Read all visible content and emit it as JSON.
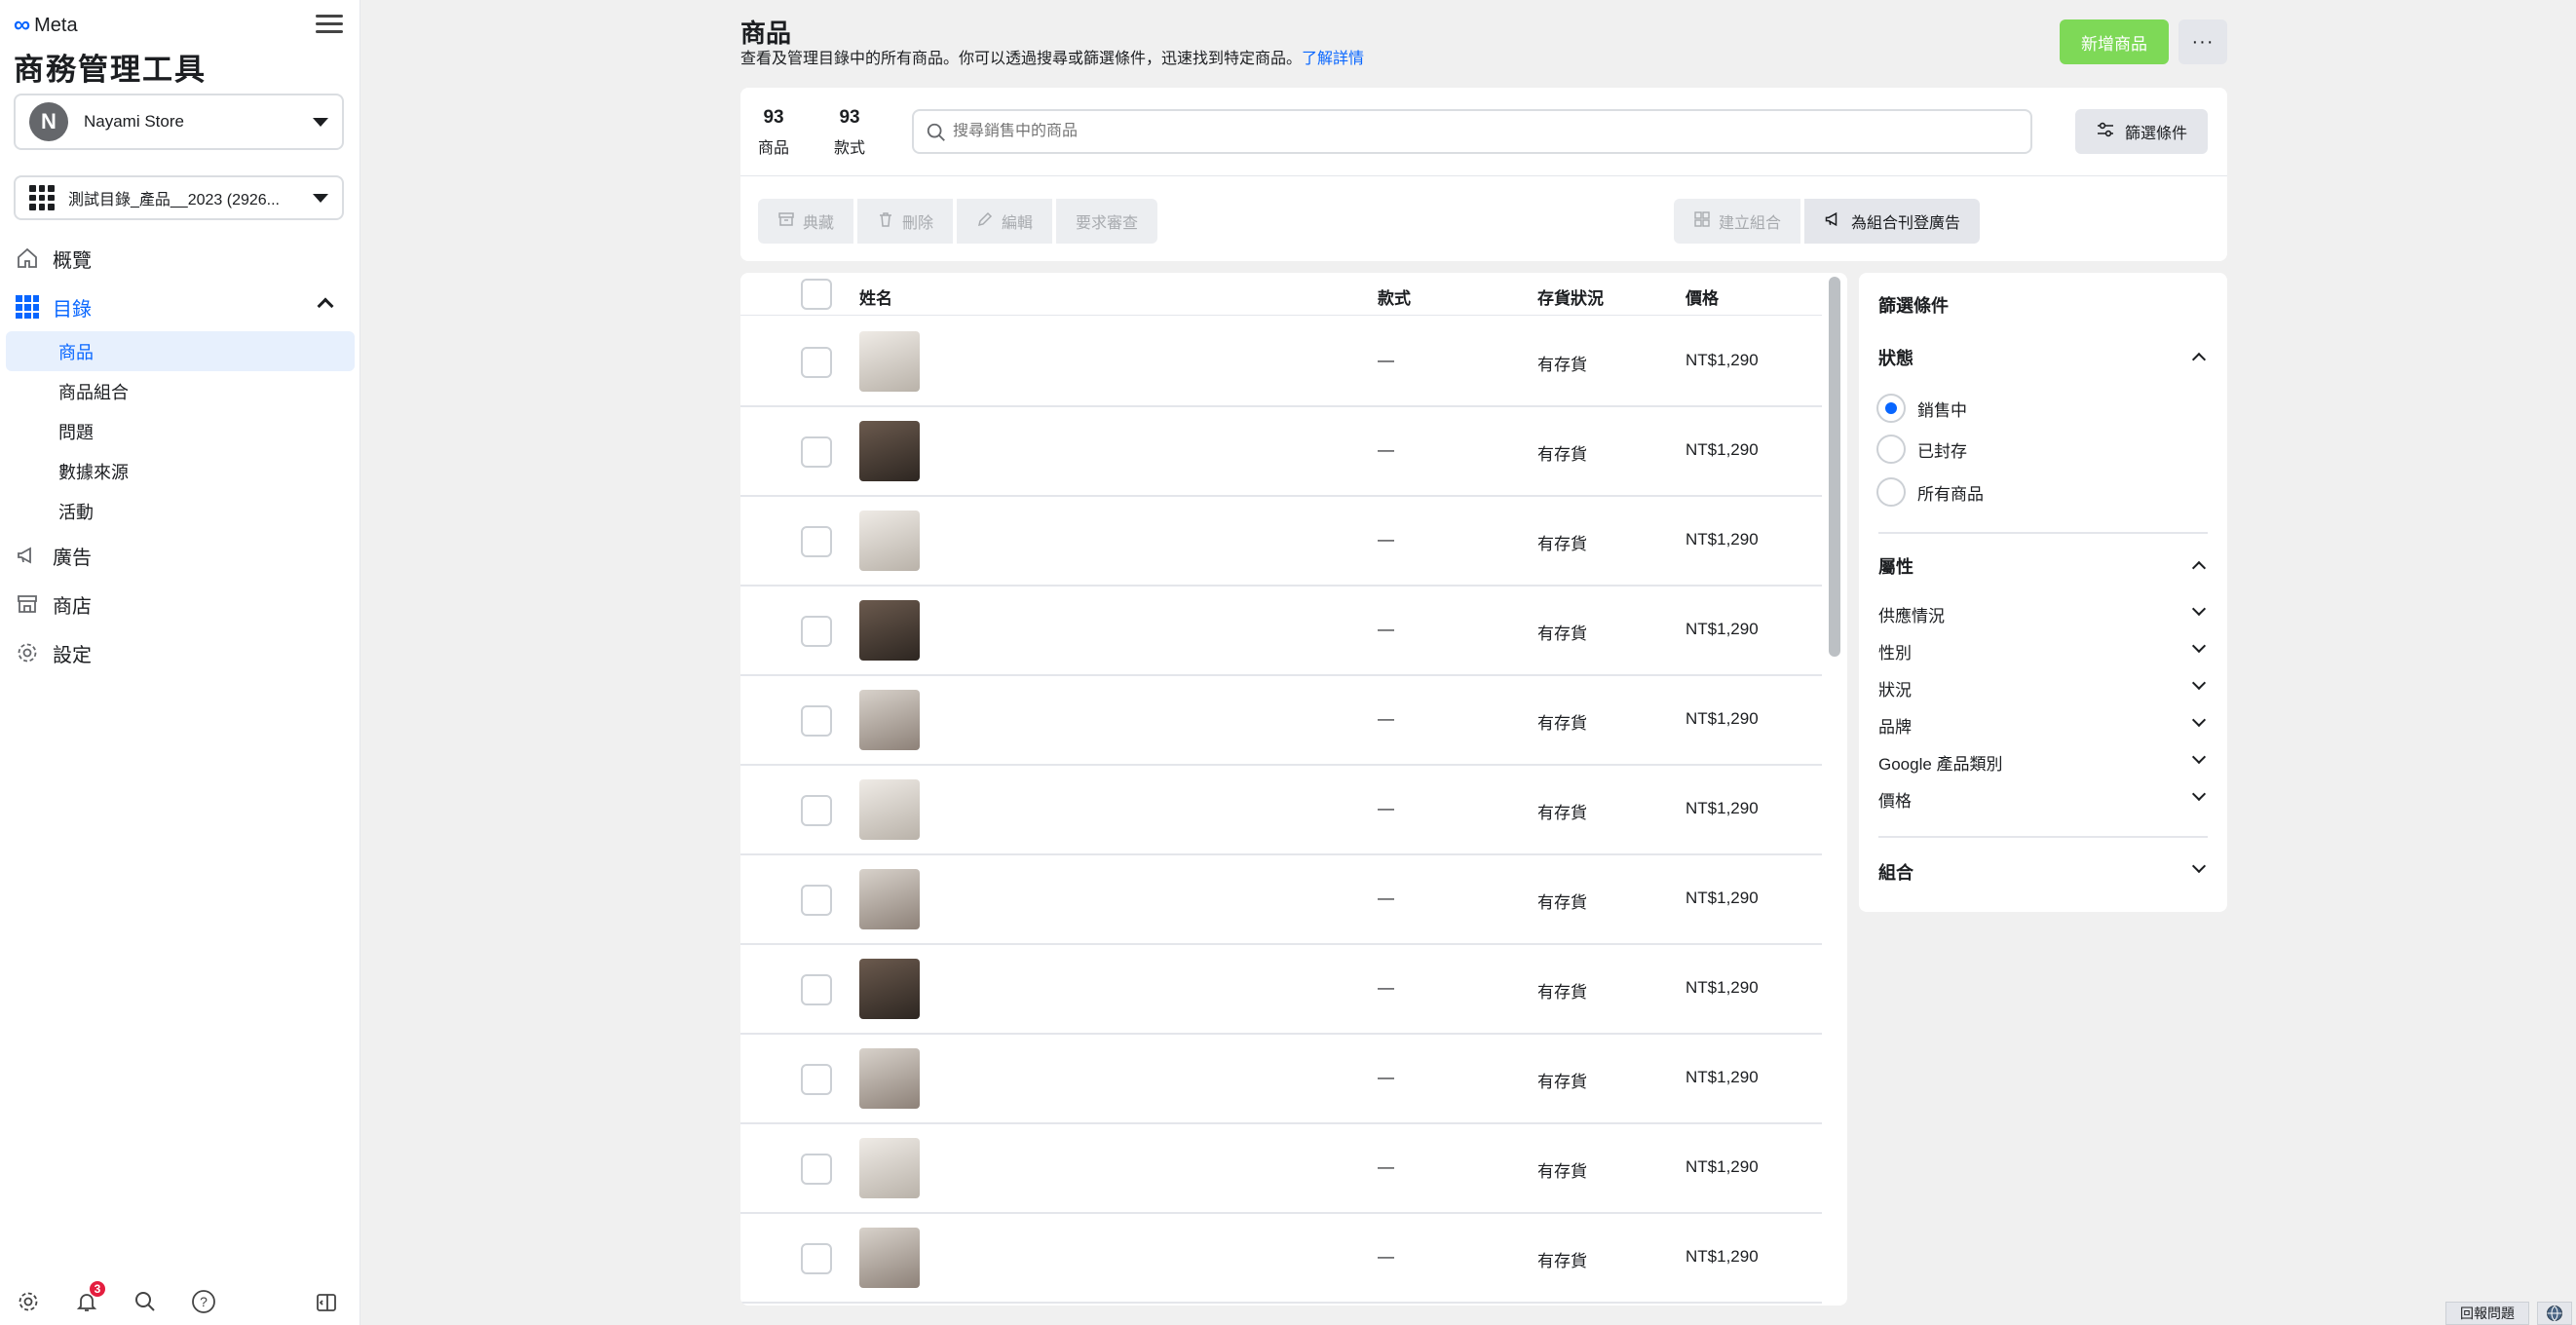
{
  "sidebar": {
    "brand": "Meta",
    "app_title": "商務管理工具",
    "store": {
      "avatar_letter": "N",
      "name": "Nayami Store"
    },
    "catalog": {
      "name": "測試目錄_產品__2023 (2926..."
    },
    "nav": {
      "overview": "概覽",
      "catalog": "目錄",
      "sub": [
        "商品",
        "商品組合",
        "問題",
        "數據來源",
        "活動"
      ],
      "ads": "廣告",
      "shop": "商店",
      "settings": "設定"
    },
    "notification_count": "3"
  },
  "header": {
    "title": "商品",
    "description": "查看及管理目錄中的所有商品。你可以透過搜尋或篩選條件，迅速找到特定商品。",
    "learn_more": "了解詳情",
    "add_button": "新增商品",
    "more_button": "···"
  },
  "summary": {
    "items_count": "93",
    "items_label": "商品",
    "variants_count": "93",
    "variants_label": "款式"
  },
  "search": {
    "placeholder": "搜尋銷售中的商品"
  },
  "filter_button": "篩選條件",
  "actions": {
    "archive": "典藏",
    "delete": "刪除",
    "edit": "編輯",
    "request_review": "要求審查",
    "create_set": "建立組合",
    "advertise_set": "為組合刊登廣告"
  },
  "table": {
    "headers": {
      "name": "姓名",
      "variant": "款式",
      "stock": "存貨狀況",
      "price": "價格"
    },
    "rows": [
      {
        "variant": "—",
        "stock": "有存貨",
        "price": "NT$1,290"
      },
      {
        "variant": "—",
        "stock": "有存貨",
        "price": "NT$1,290"
      },
      {
        "variant": "—",
        "stock": "有存貨",
        "price": "NT$1,290"
      },
      {
        "variant": "—",
        "stock": "有存貨",
        "price": "NT$1,290"
      },
      {
        "variant": "—",
        "stock": "有存貨",
        "price": "NT$1,290"
      },
      {
        "variant": "—",
        "stock": "有存貨",
        "price": "NT$1,290"
      },
      {
        "variant": "—",
        "stock": "有存貨",
        "price": "NT$1,290"
      },
      {
        "variant": "—",
        "stock": "有存貨",
        "price": "NT$1,290"
      },
      {
        "variant": "—",
        "stock": "有存貨",
        "price": "NT$1,290"
      },
      {
        "variant": "—",
        "stock": "有存貨",
        "price": "NT$1,290"
      },
      {
        "variant": "—",
        "stock": "有存貨",
        "price": "NT$1,290"
      }
    ]
  },
  "filters": {
    "title": "篩選條件",
    "status_label": "狀態",
    "status_options": [
      "銷售中",
      "已封存",
      "所有商品"
    ],
    "status_selected": "銷售中",
    "attributes_label": "屬性",
    "attributes": [
      "供應情況",
      "性別",
      "狀況",
      "品牌",
      "Google 產品類別",
      "價格"
    ],
    "sets_label": "組合"
  },
  "footer": {
    "report": "回報問題"
  },
  "colors": {
    "accent": "#0866ff",
    "add_button": "#7ed957",
    "badge": "#e41e3f"
  }
}
